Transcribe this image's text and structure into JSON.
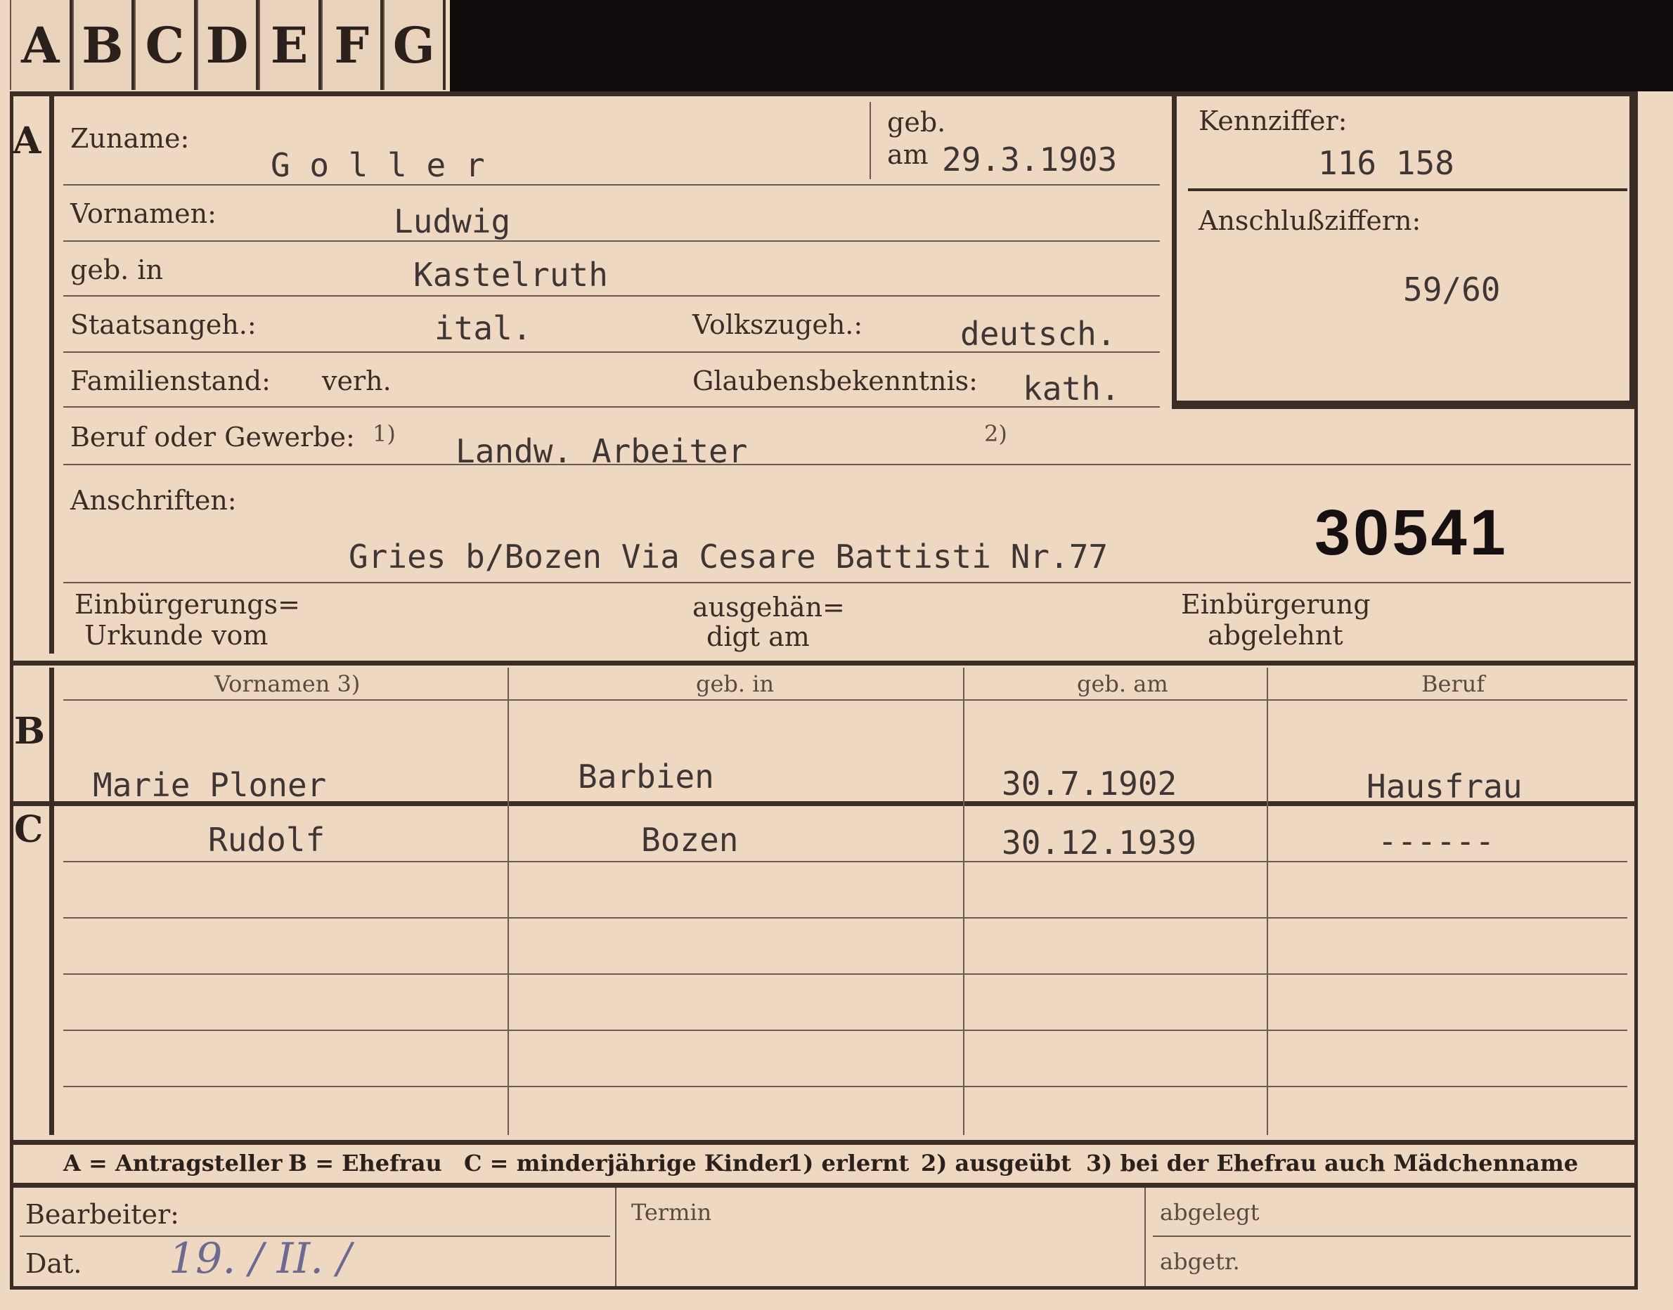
{
  "tabs": [
    "A",
    "B",
    "C",
    "D",
    "E",
    "F",
    "G"
  ],
  "sections": {
    "a": "A",
    "b": "B",
    "c": "C"
  },
  "section_a": {
    "zuname_label": "Zuname:",
    "zuname_value": "G o l l e r",
    "geb_label": "geb.",
    "am_label": "am",
    "geb_am_value": "29.3.1903",
    "vornamen_label": "Vornamen:",
    "vornamen_value": "Ludwig",
    "geb_in_label": "geb. in",
    "geb_in_value": "Kastelruth",
    "staatsangeh_label": "Staatsangeh.:",
    "staatsangeh_value": "ital.",
    "volkszugeh_label": "Volkszugeh.:",
    "volkszugeh_value": "deutsch.",
    "familienstand_label": "Familienstand:",
    "familienstand_value": "verh.",
    "glaubens_label": "Glaubensbekenntnis:",
    "glaubens_value": "kath.",
    "beruf_label": "Beruf oder Gewerbe:",
    "footnote1": "1)",
    "footnote2": "2)",
    "beruf_value": "Landw. Arbeiter",
    "anschriften_label": "Anschriften:",
    "anschriften_value": "Gries b/Bozen Via Cesare Battisti Nr.77",
    "stamp_number": "30541",
    "einb_urkunde_label_1": "Einbürgerungs=",
    "einb_urkunde_label_2": "Urkunde vom",
    "ausgehaendigt_label_1": "ausgehän=",
    "ausgehaendigt_label_2": "digt am",
    "einb_abgelehnt_label_1": "Einbürgerung",
    "einb_abgelehnt_label_2": "abgelehnt"
  },
  "side_box": {
    "kennziffer_label": "Kennziffer:",
    "kennziffer_value": "116 158",
    "anschluss_label": "Anschlußziffern:",
    "anschluss_value": "59/60"
  },
  "table": {
    "headers": [
      "Vornamen 3)",
      "geb. in",
      "geb. am",
      "Beruf"
    ],
    "ehefrau": {
      "vornamen": "Marie Ploner",
      "geb_in": "Barbien",
      "geb_am": "30.7.1902",
      "beruf": "Hausfrau"
    },
    "kinder": [
      {
        "vornamen": "Rudolf",
        "geb_in": "Bozen",
        "geb_am": "30.12.1939",
        "beruf": "------"
      }
    ]
  },
  "legend": {
    "a": "A = Antragsteller",
    "b": "B = Ehefrau",
    "c": "C = minderjährige Kinder",
    "n1": "1) erlernt",
    "n2": "2) ausgeübt",
    "n3": "3) bei der Ehefrau auch Mädchenname"
  },
  "footer": {
    "bearbeiter_label": "Bearbeiter:",
    "dat_label": "Dat.",
    "dat_value": "19. / II. /",
    "termin_label": "Termin",
    "abgelegt_label": "abgelegt",
    "abgetr_label": "abgetr."
  }
}
